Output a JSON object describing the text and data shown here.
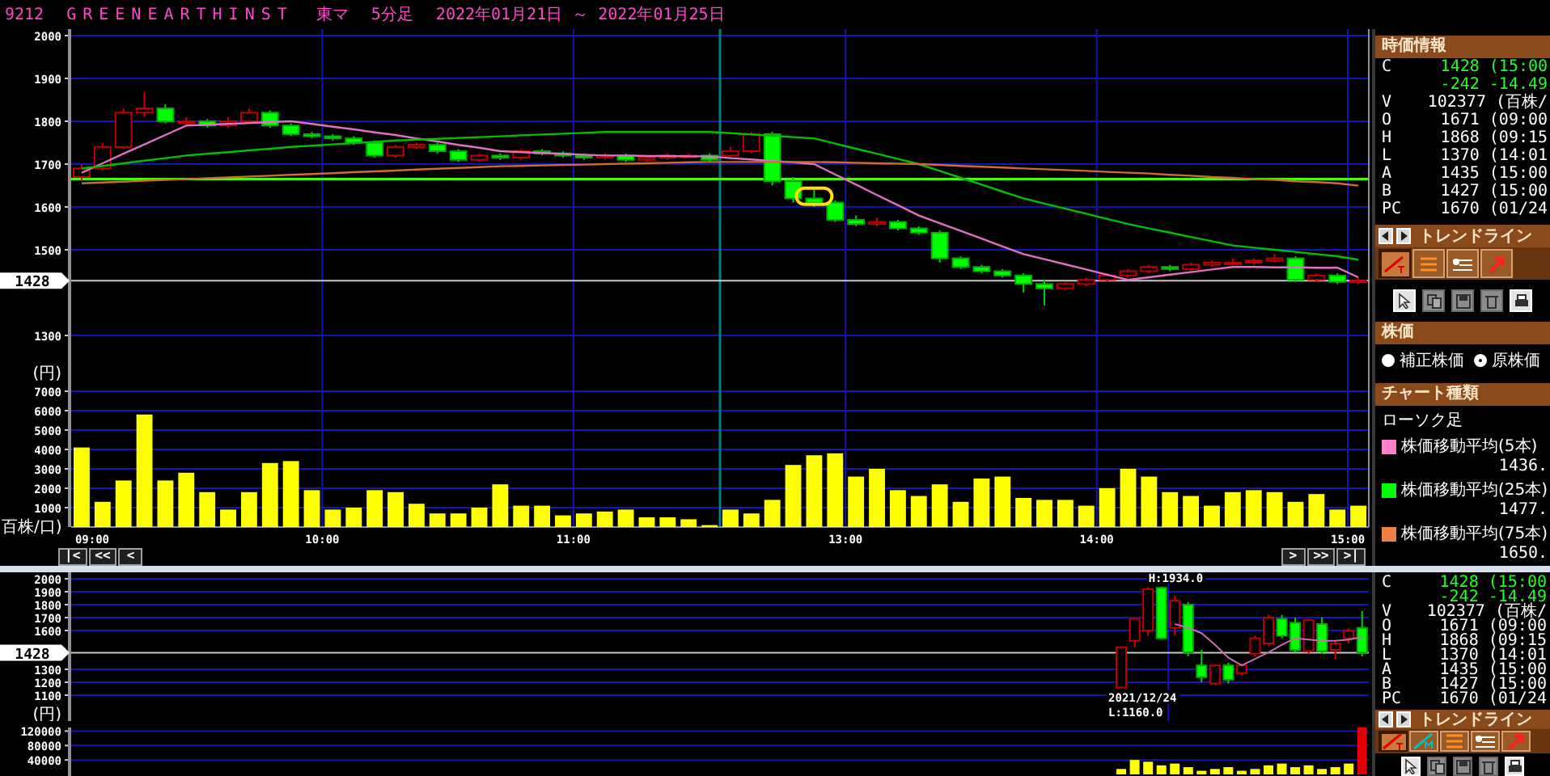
{
  "title": {
    "code": "9212",
    "name": "GREENEARTHINST",
    "market": "東マ",
    "interval": "5分足",
    "range": "2022年01月21日 ～ 2022年01月25日"
  },
  "intraday": {
    "price_chart": {
      "chart_data": {
        "type": "candlestick",
        "ylabel": "(円)",
        "ylim": [
          1200,
          2000
        ],
        "yticks": [
          2000,
          1900,
          1800,
          1700,
          1600,
          1500,
          1300
        ],
        "grid": true,
        "ohlc": [
          [
            1670,
            1700,
            1660,
            1690
          ],
          [
            1690,
            1750,
            1685,
            1740
          ],
          [
            1740,
            1830,
            1735,
            1820
          ],
          [
            1820,
            1868,
            1810,
            1830
          ],
          [
            1830,
            1840,
            1795,
            1800
          ],
          [
            1800,
            1810,
            1790,
            1800
          ],
          [
            1800,
            1805,
            1785,
            1790
          ],
          [
            1790,
            1810,
            1785,
            1800
          ],
          [
            1800,
            1830,
            1795,
            1820
          ],
          [
            1820,
            1825,
            1785,
            1790
          ],
          [
            1790,
            1795,
            1765,
            1770
          ],
          [
            1770,
            1775,
            1760,
            1765
          ],
          [
            1765,
            1770,
            1755,
            1760
          ],
          [
            1760,
            1765,
            1745,
            1750
          ],
          [
            1750,
            1755,
            1715,
            1720
          ],
          [
            1720,
            1745,
            1715,
            1740
          ],
          [
            1740,
            1750,
            1735,
            1745
          ],
          [
            1745,
            1750,
            1725,
            1730
          ],
          [
            1730,
            1735,
            1705,
            1710
          ],
          [
            1710,
            1725,
            1705,
            1720
          ],
          [
            1720,
            1725,
            1710,
            1715
          ],
          [
            1715,
            1735,
            1710,
            1730
          ],
          [
            1730,
            1735,
            1720,
            1725
          ],
          [
            1725,
            1730,
            1715,
            1720
          ],
          [
            1720,
            1725,
            1710,
            1715
          ],
          [
            1715,
            1725,
            1710,
            1720
          ],
          [
            1720,
            1725,
            1705,
            1710
          ],
          [
            1710,
            1720,
            1705,
            1715
          ],
          [
            1715,
            1725,
            1710,
            1720
          ],
          [
            1720,
            1725,
            1715,
            1720
          ],
          [
            1720,
            1725,
            1705,
            1710
          ],
          [
            1720,
            1740,
            1715,
            1730
          ],
          [
            1730,
            1775,
            1725,
            1770
          ],
          [
            1770,
            1775,
            1650,
            1660
          ],
          [
            1660,
            1670,
            1610,
            1620
          ],
          [
            1620,
            1640,
            1600,
            1610
          ],
          [
            1610,
            1615,
            1565,
            1570
          ],
          [
            1570,
            1580,
            1555,
            1560
          ],
          [
            1560,
            1575,
            1555,
            1565
          ],
          [
            1565,
            1570,
            1545,
            1550
          ],
          [
            1550,
            1555,
            1535,
            1540
          ],
          [
            1540,
            1545,
            1470,
            1480
          ],
          [
            1480,
            1485,
            1455,
            1460
          ],
          [
            1460,
            1465,
            1445,
            1450
          ],
          [
            1450,
            1455,
            1435,
            1440
          ],
          [
            1440,
            1445,
            1400,
            1420
          ],
          [
            1420,
            1430,
            1370,
            1410
          ],
          [
            1410,
            1425,
            1405,
            1420
          ],
          [
            1420,
            1435,
            1415,
            1430
          ],
          [
            1430,
            1445,
            1425,
            1440
          ],
          [
            1440,
            1455,
            1435,
            1450
          ],
          [
            1450,
            1465,
            1445,
            1460
          ],
          [
            1460,
            1465,
            1450,
            1455
          ],
          [
            1455,
            1470,
            1450,
            1465
          ],
          [
            1465,
            1475,
            1460,
            1470
          ],
          [
            1470,
            1480,
            1465,
            1470
          ],
          [
            1470,
            1480,
            1465,
            1475
          ],
          [
            1475,
            1490,
            1470,
            1480
          ],
          [
            1480,
            1485,
            1425,
            1430
          ],
          [
            1430,
            1445,
            1425,
            1440
          ],
          [
            1440,
            1445,
            1420,
            1425
          ],
          [
            1425,
            1435,
            1420,
            1428
          ]
        ],
        "series": [
          {
            "type": "line",
            "color": "#e070c0",
            "values": [
              1680,
              1702,
              1724,
              1746,
              1768,
              1790,
              1792,
              1794,
              1796,
              1798,
              1800,
              1794,
              1787,
              1781,
              1774,
              1768,
              1760,
              1753,
              1745,
              1738,
              1730,
              1728,
              1726,
              1724,
              1722,
              1720,
              1720,
              1719,
              1719,
              1718,
              1718,
              1714,
              1711,
              1707,
              1704,
              1700,
              1676,
              1652,
              1628,
              1604,
              1580,
              1562,
              1544,
              1526,
              1508,
              1490,
              1478,
              1466,
              1454,
              1442,
              1430,
              1436,
              1442,
              1448,
              1454,
              1460,
              1460,
              1459,
              1459,
              1458,
              1458,
              1436
            ]
          },
          {
            "type": "line",
            "color": "#00c000",
            "values": [
              1690,
              1696,
              1702,
              1708,
              1714,
              1720,
              1724,
              1728,
              1732,
              1736,
              1740,
              1743,
              1746,
              1749,
              1752,
              1755,
              1757,
              1759,
              1761,
              1763,
              1765,
              1767,
              1769,
              1771,
              1773,
              1775,
              1775,
              1775,
              1775,
              1775,
              1775,
              1772,
              1769,
              1766,
              1763,
              1760,
              1748,
              1736,
              1724,
              1712,
              1700,
              1684,
              1668,
              1652,
              1636,
              1620,
              1608,
              1596,
              1584,
              1572,
              1560,
              1550,
              1540,
              1530,
              1520,
              1510,
              1505,
              1500,
              1495,
              1490,
              1485,
              1477
            ]
          },
          {
            "type": "line",
            "color": "#d06a30",
            "values": [
              1655,
              1657,
              1659,
              1661,
              1663,
              1665,
              1667,
              1669,
              1671,
              1673,
              1675,
              1677,
              1679,
              1681,
              1683,
              1685,
              1687,
              1689,
              1691,
              1693,
              1695,
              1696,
              1697,
              1698,
              1699,
              1700,
              1701,
              1702,
              1703,
              1704,
              1705,
              1705,
              1705,
              1705,
              1705,
              1705,
              1704,
              1703,
              1702,
              1701,
              1700,
              1698,
              1696,
              1694,
              1692,
              1690,
              1688,
              1686,
              1684,
              1682,
              1680,
              1678,
              1675,
              1673,
              1670,
              1668,
              1665,
              1663,
              1660,
              1658,
              1655,
              1650
            ]
          }
        ],
        "ref_lines": [
          {
            "axis": "y",
            "value": 1665,
            "color": "#40ff00"
          },
          {
            "axis": "y",
            "value": 1428,
            "label": "1428",
            "color": "#c8c8c8"
          }
        ]
      }
    },
    "volume_chart": {
      "chart_data": {
        "type": "bar",
        "ylabel": "百株/口)",
        "ylim": [
          0,
          7000
        ],
        "yticks": [
          1000,
          2000,
          3000,
          4000,
          5000,
          6000,
          7000
        ],
        "grid": true,
        "categories": [
          "09:00",
          null,
          null,
          null,
          null,
          null,
          null,
          null,
          null,
          null,
          null,
          null,
          "10:00",
          null,
          null,
          null,
          null,
          null,
          null,
          null,
          null,
          null,
          null,
          null,
          "11:00",
          null,
          null,
          null,
          null,
          null,
          null,
          null,
          null,
          null,
          null,
          null,
          null,
          "13:00",
          null,
          null,
          null,
          null,
          null,
          null,
          null,
          null,
          null,
          null,
          null,
          "14:00",
          null,
          null,
          null,
          null,
          null,
          null,
          null,
          null,
          null,
          null,
          null,
          "15:00"
        ],
        "series": [
          {
            "color": "#ffff00",
            "values": [
              4100,
              1300,
              2400,
              5800,
              2400,
              2800,
              1800,
              900,
              1800,
              3300,
              3400,
              1900,
              900,
              1000,
              1900,
              1800,
              1200,
              700,
              700,
              1000,
              2200,
              1100,
              1100,
              600,
              700,
              800,
              900,
              500,
              500,
              400,
              100,
              900,
              700,
              1400,
              3200,
              3700,
              3800,
              2600,
              3000,
              1900,
              1600,
              2200,
              1300,
              2500,
              2600,
              1500,
              1400,
              1400,
              1100,
              2000,
              3000,
              2600,
              1800,
              1600,
              1100,
              1800,
              1900,
              1800,
              1300,
              1700,
              900,
              1100
            ]
          }
        ]
      }
    },
    "nav": {
      "left": [
        "|<",
        "<<",
        "<"
      ],
      "right": [
        ">",
        ">>",
        ">|"
      ]
    }
  },
  "daily": {
    "price_chart": {
      "chart_data": {
        "type": "candlestick",
        "ylabel": "(円)",
        "ylim": [
          900,
          2000
        ],
        "yticks": [
          2000,
          1900,
          1800,
          1700,
          1600,
          1300,
          1200,
          1100
        ],
        "grid": true,
        "ohlc": [
          null,
          null,
          null,
          null,
          null,
          null,
          null,
          null,
          null,
          null,
          null,
          null,
          null,
          null,
          null,
          null,
          null,
          null,
          null,
          null,
          null,
          null,
          null,
          null,
          null,
          null,
          null,
          null,
          null,
          null,
          null,
          null,
          null,
          null,
          null,
          null,
          null,
          null,
          null,
          null,
          null,
          null,
          null,
          null,
          null,
          null,
          null,
          null,
          null,
          null,
          null,
          null,
          null,
          null,
          null,
          null,
          null,
          null,
          null,
          null,
          null,
          null,
          null,
          null,
          null,
          null,
          null,
          null,
          null,
          null,
          null,
          null,
          null,
          null,
          null,
          null,
          null,
          null,
          [
            1160,
            1480,
            1160,
            1470
          ],
          [
            1520,
            1700,
            1470,
            1690
          ],
          [
            1600,
            1934,
            1560,
            1920
          ],
          [
            1930,
            1940,
            1530,
            1540
          ],
          [
            1620,
            1870,
            1560,
            1830
          ],
          [
            1800,
            1820,
            1400,
            1430
          ],
          [
            1330,
            1450,
            1200,
            1240
          ],
          [
            1190,
            1340,
            1180,
            1330
          ],
          [
            1330,
            1350,
            1190,
            1220
          ],
          [
            1270,
            1340,
            1250,
            1330
          ],
          [
            1420,
            1560,
            1400,
            1540
          ],
          [
            1500,
            1720,
            1480,
            1700
          ],
          [
            1690,
            1720,
            1540,
            1560
          ],
          [
            1660,
            1700,
            1430,
            1450
          ],
          [
            1440,
            1690,
            1420,
            1680
          ],
          [
            1650,
            1700,
            1420,
            1440
          ],
          [
            1450,
            1520,
            1380,
            1500
          ],
          [
            1540,
            1620,
            1500,
            1600
          ],
          [
            1620,
            1750,
            1400,
            1428
          ]
        ],
        "series": [
          {
            "type": "line",
            "color": "#c070b0",
            "values": [
              null,
              null,
              null,
              null,
              null,
              null,
              null,
              null,
              null,
              null,
              null,
              null,
              null,
              null,
              null,
              null,
              null,
              null,
              null,
              null,
              null,
              null,
              null,
              null,
              null,
              null,
              null,
              null,
              null,
              null,
              null,
              null,
              null,
              null,
              null,
              null,
              null,
              null,
              null,
              null,
              null,
              null,
              null,
              null,
              null,
              null,
              null,
              null,
              null,
              null,
              null,
              null,
              null,
              null,
              null,
              null,
              null,
              null,
              null,
              null,
              null,
              null,
              null,
              null,
              null,
              null,
              null,
              null,
              null,
              null,
              null,
              null,
              null,
              null,
              null,
              null,
              null,
              null,
              null,
              null,
              null,
              null,
              1650,
              1620,
              1580,
              1490,
              1390,
              1330,
              1380,
              1430,
              1490,
              1540,
              1530,
              1520,
              1520,
              1530,
              1550
            ]
          }
        ],
        "ref_lines": [
          {
            "axis": "y",
            "value": 1428,
            "label": "1428",
            "color": "#c8c8c8"
          }
        ],
        "annotations": [
          "H:1934.0",
          "2021/12/24",
          "L:1160.0"
        ]
      }
    },
    "volume_chart": {
      "chart_data": {
        "type": "bar",
        "ylim": [
          0,
          130000
        ],
        "yticks": [
          120000,
          80000,
          40000
        ],
        "grid": true,
        "stacked": true,
        "series": [
          {
            "color": "#ffff00",
            "values": [
              null,
              null,
              null,
              null,
              null,
              null,
              null,
              null,
              null,
              null,
              null,
              null,
              null,
              null,
              null,
              null,
              null,
              null,
              null,
              null,
              null,
              null,
              null,
              null,
              null,
              null,
              null,
              null,
              null,
              null,
              null,
              null,
              null,
              null,
              null,
              null,
              null,
              null,
              null,
              null,
              null,
              null,
              null,
              null,
              null,
              null,
              null,
              null,
              null,
              null,
              null,
              null,
              null,
              null,
              null,
              null,
              null,
              null,
              null,
              null,
              null,
              null,
              null,
              null,
              null,
              null,
              null,
              null,
              null,
              null,
              null,
              null,
              null,
              null,
              null,
              null,
              null,
              null,
              15000,
              40000,
              35000,
              25000,
              30000,
              20000,
              10000,
              15000,
              20000,
              10000,
              15000,
              25000,
              30000,
              20000,
              25000,
              15000,
              20000,
              30000,
              null
            ]
          },
          {
            "color": "#e00000",
            "values": [
              null,
              null,
              null,
              null,
              null,
              null,
              null,
              null,
              null,
              null,
              null,
              null,
              null,
              null,
              null,
              null,
              null,
              null,
              null,
              null,
              null,
              null,
              null,
              null,
              null,
              null,
              null,
              null,
              null,
              null,
              null,
              null,
              null,
              null,
              null,
              null,
              null,
              null,
              null,
              null,
              null,
              null,
              null,
              null,
              null,
              null,
              null,
              null,
              null,
              null,
              null,
              null,
              null,
              null,
              null,
              null,
              null,
              null,
              null,
              null,
              null,
              null,
              null,
              null,
              null,
              null,
              null,
              null,
              null,
              null,
              null,
              null,
              null,
              null,
              null,
              null,
              null,
              null,
              null,
              null,
              null,
              null,
              null,
              null,
              null,
              null,
              null,
              null,
              null,
              null,
              null,
              null,
              null,
              null,
              null,
              null,
              130000
            ]
          }
        ]
      }
    }
  },
  "side_top": {
    "quote_header": "時価情報",
    "quote": [
      {
        "label": "C",
        "value": "1428 (15:00",
        "highlight": true
      },
      {
        "value": "-242 -14.49",
        "highlight": true
      },
      {
        "label": "V",
        "value": "102377 (百株/",
        "highlight": false
      },
      {
        "label": "O",
        "value": "1671 (09:00",
        "highlight": false
      },
      {
        "label": "H",
        "value": "1868 (09:15",
        "highlight": false
      },
      {
        "label": "L",
        "value": "1370 (14:01",
        "highlight": false
      },
      {
        "label": "A",
        "value": "1435 (15:00",
        "highlight": false
      },
      {
        "label": "B",
        "value": "1427 (15:00",
        "highlight": false
      },
      {
        "label": "PC",
        "value": "1670 (01/24",
        "highlight": false
      }
    ],
    "trendline": {
      "title": "トレンドライン",
      "tools": [
        {
          "kind": "line",
          "selected": true
        },
        {
          "kind": "hlines",
          "selected": false
        },
        {
          "kind": "text",
          "selected": false
        },
        {
          "kind": "arrow",
          "selected": false
        }
      ]
    },
    "actions": [
      {
        "kind": "pointer",
        "disabled": false
      },
      {
        "kind": "copy",
        "disabled": true
      },
      {
        "kind": "save",
        "disabled": true
      },
      {
        "kind": "trash",
        "disabled": true
      },
      {
        "kind": "print",
        "disabled": false
      }
    ],
    "price_type": {
      "title": "株価",
      "options": [
        {
          "label": "補正株価",
          "selected": false
        },
        {
          "label": "原株価",
          "selected": true
        }
      ]
    },
    "chart_type": {
      "title": "チャート種類",
      "style": "ローソク足",
      "legend": [
        {
          "label": "株価移動平均(5本)",
          "value": "1436.",
          "color": "#ff80c8"
        },
        {
          "label": "株価移動平均(25本)",
          "value": "1477.",
          "color": "#00ff00"
        },
        {
          "label": "株価移動平均(75本)",
          "value": "1650.",
          "color": "#f08040"
        }
      ]
    }
  },
  "side_bottom": {
    "quote": [
      {
        "label": "C",
        "value": "1428 (15:00",
        "highlight": true
      },
      {
        "value": "-242 -14.49",
        "highlight": true
      },
      {
        "label": "V",
        "value": "102377 (百株/",
        "highlight": false
      },
      {
        "label": "O",
        "value": "1671 (09:00",
        "highlight": false
      },
      {
        "label": "H",
        "value": "1868 (09:15",
        "highlight": false
      },
      {
        "label": "L",
        "value": "1370 (14:01",
        "highlight": false
      },
      {
        "label": "A",
        "value": "1435 (15:00",
        "highlight": false
      },
      {
        "label": "B",
        "value": "1427 (15:00",
        "highlight": false
      },
      {
        "label": "PC",
        "value": "1670 (01/24",
        "highlight": false
      }
    ],
    "trendline": {
      "title": "トレンドライン",
      "tools": [
        {
          "kind": "line",
          "selected": true
        },
        {
          "kind": "line-m",
          "selected": false
        },
        {
          "kind": "hlines",
          "selected": false
        },
        {
          "kind": "text",
          "selected": false
        },
        {
          "kind": "arrow",
          "selected": false
        }
      ]
    },
    "actions": [
      {
        "kind": "pointer",
        "disabled": false
      },
      {
        "kind": "copy",
        "disabled": true
      },
      {
        "kind": "save",
        "disabled": true
      },
      {
        "kind": "trash",
        "disabled": true
      },
      {
        "kind": "print",
        "disabled": false
      }
    ]
  }
}
